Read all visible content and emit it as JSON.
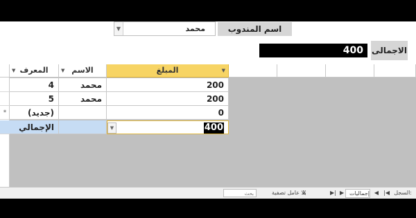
{
  "form": {
    "rep_label": "اسم المندوب",
    "rep_value": "محمد",
    "total_label": "الاجمالى",
    "total_value": "400"
  },
  "grid": {
    "columns": [
      "المعرف",
      "الاسم",
      "المبلغ"
    ],
    "rows": [
      {
        "id": "4",
        "name": "محمد",
        "amount": "200",
        "marker": ""
      },
      {
        "id": "5",
        "name": "محمد",
        "amount": "200",
        "marker": ""
      },
      {
        "id": "(جديد)",
        "name": "",
        "amount": "0",
        "marker": "*"
      }
    ],
    "total_row": {
      "id": "الإجمالي",
      "name": "",
      "amount": "400"
    }
  },
  "status": {
    "record_label": "السجل:",
    "nav_first": "|◀",
    "nav_prev": "◀",
    "record_value": "إجماليات",
    "nav_next": "▶",
    "nav_last": "▶|",
    "filter_label": "بلا عامل تصفية",
    "search_placeholder": "بحث"
  },
  "icons": {
    "dropdown": "chevron-down-icon",
    "new_record": "asterisk-icon",
    "filter": "filter-icon"
  },
  "colors": {
    "header_selected": "#f7d464",
    "total_row": "#c6dcf4",
    "grid_background": "#c0c0c0"
  }
}
